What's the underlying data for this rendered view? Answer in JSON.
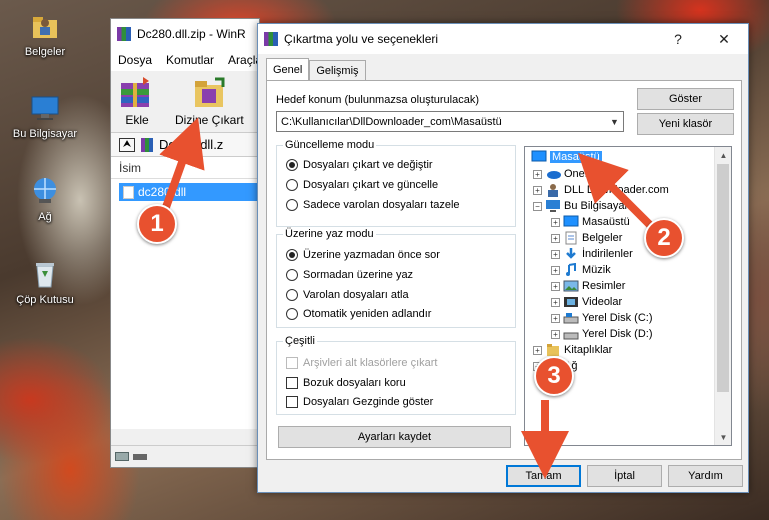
{
  "desktop": {
    "icons": [
      {
        "label": "Belgeler",
        "icon": "folder-user-icon"
      },
      {
        "label": "Bu Bilgisayar",
        "icon": "computer-icon"
      },
      {
        "label": "Ağ",
        "icon": "network-icon"
      },
      {
        "label": "Çöp Kutusu",
        "icon": "recycle-bin-icon"
      }
    ]
  },
  "winrar": {
    "title": "Dc280.dll.zip - WinR",
    "menu": [
      "Dosya",
      "Komutlar",
      "Araçla"
    ],
    "toolbar": {
      "add_label": "Ekle",
      "extract_label": "Dizine Çıkart"
    },
    "address": "Dc280.dll.z",
    "column_name": "İsim",
    "file": "dc280.dll"
  },
  "dialog": {
    "title": "Çıkartma yolu ve seçenekleri",
    "help_glyph": "?",
    "close_glyph": "✕",
    "tabs": [
      "Genel",
      "Gelişmiş"
    ],
    "dest_label": "Hedef konum (bulunmazsa oluşturulacak)",
    "dest_value": "C:\\Kullanıcılar\\DllDownloader_com\\Masaüstü",
    "show_button": "Göster",
    "new_folder_button": "Yeni klasör",
    "update_mode": {
      "title": "Güncelleme modu",
      "options": [
        "Dosyaları çıkart ve değiştir",
        "Dosyaları çıkart ve güncelle",
        "Sadece varolan dosyaları tazele"
      ],
      "selected": 0
    },
    "overwrite_mode": {
      "title": "Üzerine yaz modu",
      "options": [
        "Üzerine yazmadan önce sor",
        "Sormadan üzerine yaz",
        "Varolan dosyaları atla",
        "Otomatik yeniden adlandır"
      ],
      "selected": 0
    },
    "misc": {
      "title": "Çeşitli",
      "options": [
        "Arşivleri alt klasörlere çıkart",
        "Bozuk dosyaları koru",
        "Dosyaları Gezginde göster"
      ],
      "disabled": [
        true,
        false,
        false
      ],
      "checked": [
        false,
        false,
        false
      ]
    },
    "save_settings_button": "Ayarları kaydet",
    "tree": [
      {
        "label": "Masaüstü",
        "icon": "desktop-icon",
        "selected": true
      },
      {
        "label": "OneDrive",
        "icon": "onedrive-icon"
      },
      {
        "label": "DLL Downloader.com",
        "icon": "user-icon"
      },
      {
        "label": "Bu Bilgisayar",
        "icon": "computer-icon"
      },
      {
        "label": "Masaüstü",
        "icon": "desktop-icon"
      },
      {
        "label": "Belgeler",
        "icon": "documents-icon"
      },
      {
        "label": "İndirilenler",
        "icon": "downloads-icon"
      },
      {
        "label": "Müzik",
        "icon": "music-icon"
      },
      {
        "label": "Resimler",
        "icon": "pictures-icon"
      },
      {
        "label": "Videolar",
        "icon": "videos-icon"
      },
      {
        "label": "Yerel Disk (C:)",
        "icon": "drive-icon"
      },
      {
        "label": "Yerel Disk (D:)",
        "icon": "drive-icon"
      },
      {
        "label": "Kitaplıklar",
        "icon": "libraries-icon"
      },
      {
        "label": "Ağ",
        "icon": "network-icon"
      }
    ],
    "ok_button": "Tamam",
    "cancel_button": "İptal",
    "help_button": "Yardım"
  },
  "annotations": {
    "step1": "1",
    "step2": "2",
    "step3": "3",
    "color": "#e8512f"
  }
}
